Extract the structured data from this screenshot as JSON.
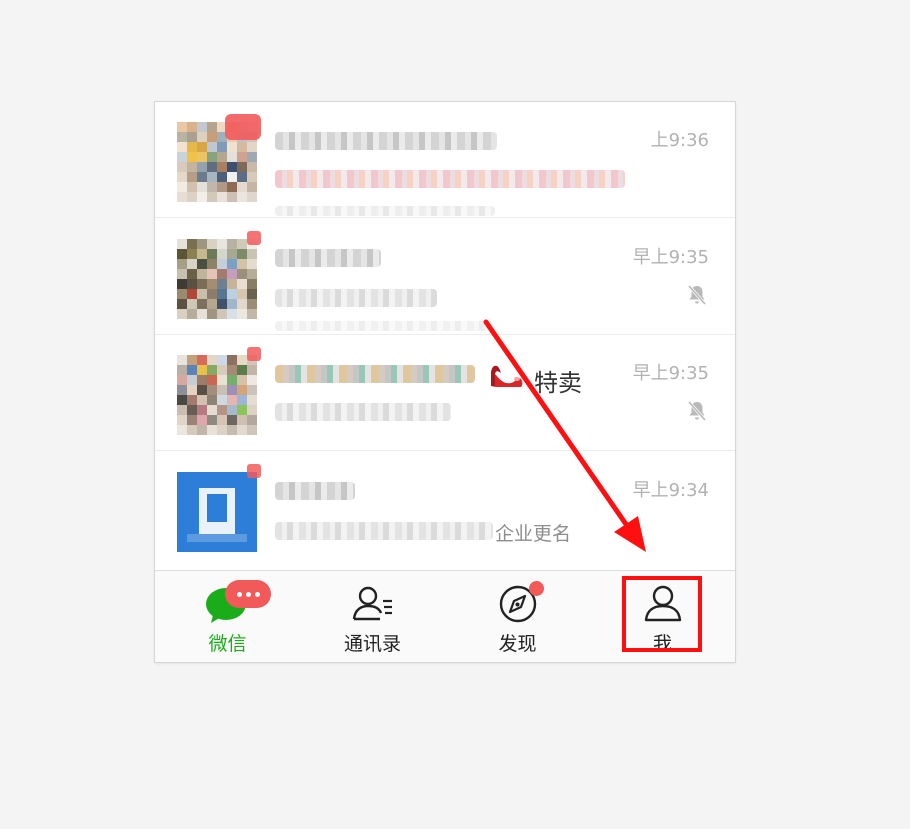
{
  "chat_list": {
    "items": [
      {
        "time": "上9:36",
        "muted": false,
        "badge": "large"
      },
      {
        "time": "早上9:35",
        "muted": true,
        "badge": "dot"
      },
      {
        "time": "早上9:35",
        "muted": true,
        "badge": "dot",
        "visible_text": "特卖",
        "emoji_icon": "high-heel-icon"
      },
      {
        "time": "早上9:34",
        "muted": false,
        "badge": "dot",
        "visible_text": "企业更名"
      }
    ]
  },
  "tabbar": {
    "tabs": [
      {
        "label": "微信",
        "icon": "chat-bubble-icon",
        "active": true,
        "badge": "..."
      },
      {
        "label": "通讯录",
        "icon": "contacts-icon",
        "active": false
      },
      {
        "label": "发现",
        "icon": "compass-icon",
        "active": false,
        "dot": true
      },
      {
        "label": "我",
        "icon": "person-icon",
        "active": false,
        "highlighted": true
      }
    ]
  },
  "colors": {
    "accent_green": "#1aad19",
    "badge_red": "#f25a5a",
    "annotation_red": "#ff1010",
    "time_gray": "#b2b2b2"
  }
}
